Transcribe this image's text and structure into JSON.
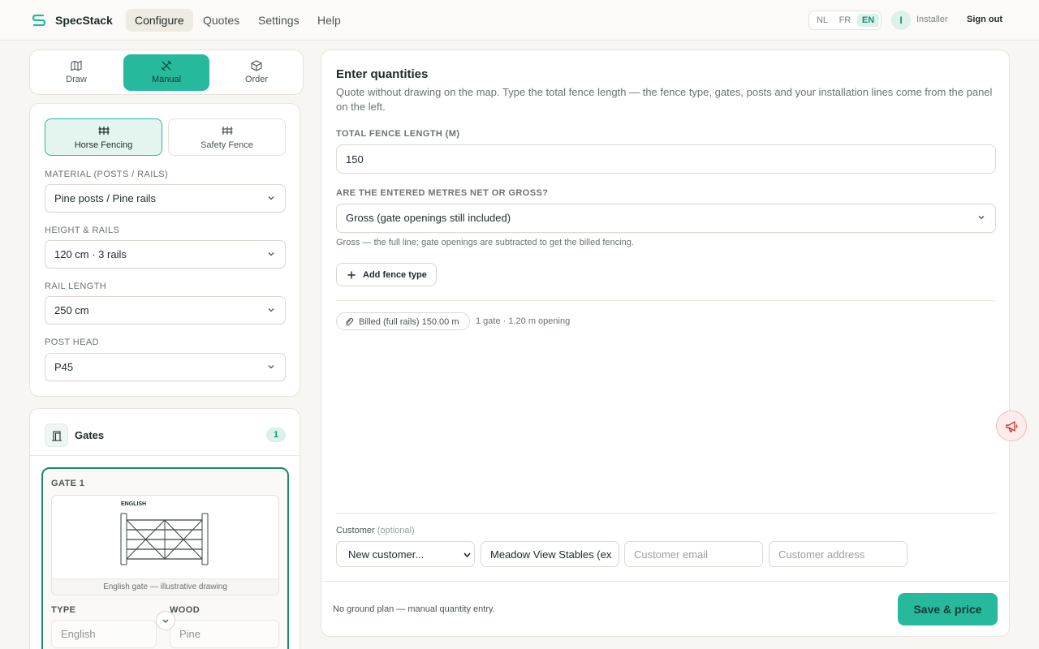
{
  "app": {
    "brand": "SpecStack"
  },
  "nav": {
    "items": [
      "Configure",
      "Quotes",
      "Settings",
      "Help"
    ],
    "active": "Configure"
  },
  "lang": {
    "options": [
      "NL",
      "FR",
      "EN"
    ],
    "active": "EN"
  },
  "user": {
    "initial": "I",
    "role": "Installer",
    "signout": "Sign out"
  },
  "modes": {
    "draw": "Draw",
    "manual": "Manual",
    "order": "Order",
    "active": "Manual"
  },
  "fence_types": {
    "horse": "Horse Fencing",
    "safety": "Safety Fence",
    "active": "Horse Fencing"
  },
  "config": {
    "material": {
      "label": "Material (posts / rails)",
      "value": "Pine posts / Pine rails"
    },
    "height": {
      "label": "Height & rails",
      "value": "120 cm · 3 rails"
    },
    "rail_length": {
      "label": "Rail length",
      "value": "250 cm"
    },
    "post_head": {
      "label": "Post head",
      "value": "P45"
    }
  },
  "gates": {
    "title": "Gates",
    "count": "1",
    "gate1": {
      "title": "Gate 1",
      "drawing_label": "ENGLISH",
      "caption": "English gate — illustrative drawing",
      "type_label": "Type",
      "type_value": "English",
      "wood_label": "Wood",
      "wood_value": "Pine"
    }
  },
  "main": {
    "title": "Enter quantities",
    "description": "Quote without drawing on the map. Type the total fence length — the fence type, gates, posts and your installation lines come from the panel on the left.",
    "length_label": "Total fence length (m)",
    "length_value": "150",
    "netgross_label": "Are the entered metres net or gross?",
    "netgross_value": "Gross (gate openings still included)",
    "netgross_hint": "Gross — the full line; gate openings are subtracted to get the billed fencing.",
    "add_fence_type": "Add fence type",
    "billed_chip": "Billed (full rails) 150.00 m",
    "gate_summary": "1 gate · 1.20 m opening"
  },
  "customer": {
    "label": "Customer",
    "optional": "(optional)",
    "select_value": "New customer...",
    "name_value": "Meadow View Stables (ex",
    "email_placeholder": "Customer email",
    "address_placeholder": "Customer address"
  },
  "footer": {
    "note": "No ground plan — manual quantity entry.",
    "save": "Save & price"
  },
  "colors": {
    "accent": "#26b99b",
    "accent_light": "#dcf1ea",
    "background": "#f7f6f3"
  }
}
